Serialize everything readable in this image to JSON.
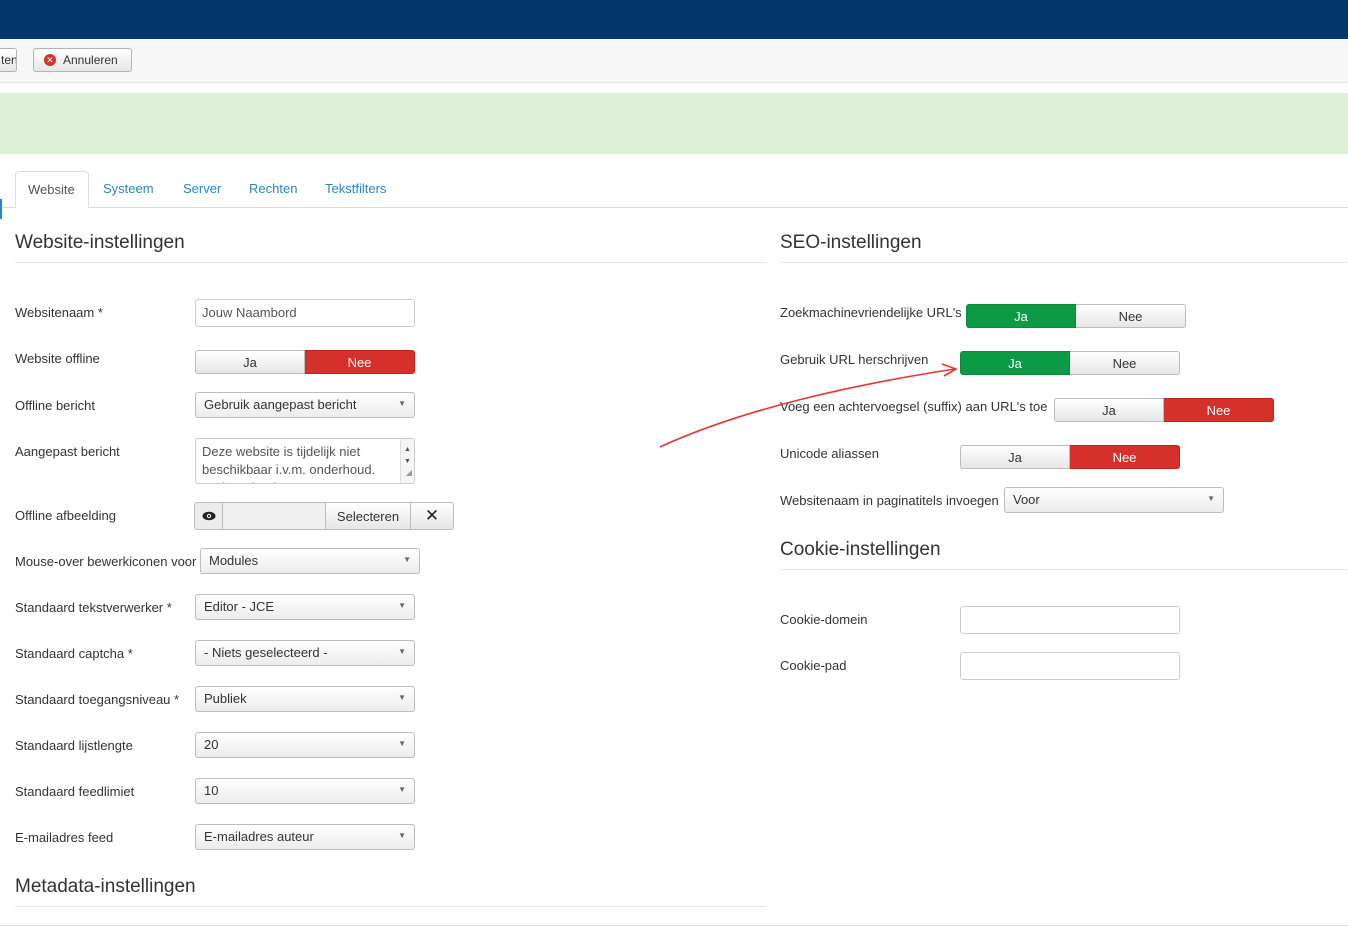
{
  "toolbar": {
    "partial_button_label": "ten",
    "cancel_label": "Annuleren",
    "cancel_icon": "cancel-circle-icon"
  },
  "tabs": [
    "Website",
    "Systeem",
    "Server",
    "Rechten",
    "Tekstfilters"
  ],
  "website": {
    "title": "Website-instellingen",
    "site_name": {
      "label": "Websitenaam *",
      "value": "Jouw Naambord"
    },
    "offline": {
      "label": "Website offline",
      "yes": "Ja",
      "no": "Nee",
      "selected": "Nee"
    },
    "offline_message": {
      "label": "Offline bericht",
      "value": "Gebruik aangepast bericht"
    },
    "custom_message": {
      "label": "Aangepast bericht",
      "value": "Deze website is tijdelijk niet beschikbaar i.v.m. onderhoud. Probeer het later nog eens."
    },
    "offline_image": {
      "label": "Offline afbeelding",
      "select_label": "Selecteren",
      "preview_icon": "eye-icon",
      "clear_icon": "close-icon"
    },
    "hover_icons": {
      "label": "Mouse-over bewerkiconen voor",
      "value": "Modules"
    },
    "default_editor": {
      "label": "Standaard tekstverwerker *",
      "value": "Editor - JCE"
    },
    "default_captcha": {
      "label": "Standaard captcha *",
      "value": "- Niets geselecteerd -"
    },
    "default_access": {
      "label": "Standaard toegangsniveau *",
      "value": "Publiek"
    },
    "list_limit": {
      "label": "Standaard lijstlengte",
      "value": "20"
    },
    "feed_limit": {
      "label": "Standaard feedlimiet",
      "value": "10"
    },
    "feed_email": {
      "label": "E-mailadres feed",
      "value": "E-mailadres auteur"
    }
  },
  "metadata": {
    "title": "Metadata-instellingen"
  },
  "seo": {
    "title": "SEO-instellingen",
    "sef_urls": {
      "label": "Zoekmachinevriendelijke URL's",
      "yes": "Ja",
      "no": "Nee",
      "selected": "Ja"
    },
    "url_rewrite": {
      "label": "Gebruik URL herschrijven",
      "yes": "Ja",
      "no": "Nee",
      "selected": "Ja"
    },
    "suffix": {
      "label": "Voeg een achtervoegsel (suffix) aan URL's toe",
      "yes": "Ja",
      "no": "Nee",
      "selected": "Nee"
    },
    "unicode": {
      "label": "Unicode aliassen",
      "yes": "Ja",
      "no": "Nee",
      "selected": "Nee"
    },
    "sitename_pagetitles": {
      "label": "Websitenaam in paginatitels invoegen",
      "value": "Voor"
    }
  },
  "cookie": {
    "title": "Cookie-instellingen",
    "domain": {
      "label": "Cookie-domein",
      "value": ""
    },
    "path": {
      "label": "Cookie-pad",
      "value": ""
    }
  },
  "colors": {
    "topbar": "#04366c",
    "success_bar": "#dff0d8",
    "toggle_yes": "#0c9b44",
    "toggle_no": "#d6302b",
    "link": "#2a85c3",
    "annotation_arrow": "#e53535"
  }
}
